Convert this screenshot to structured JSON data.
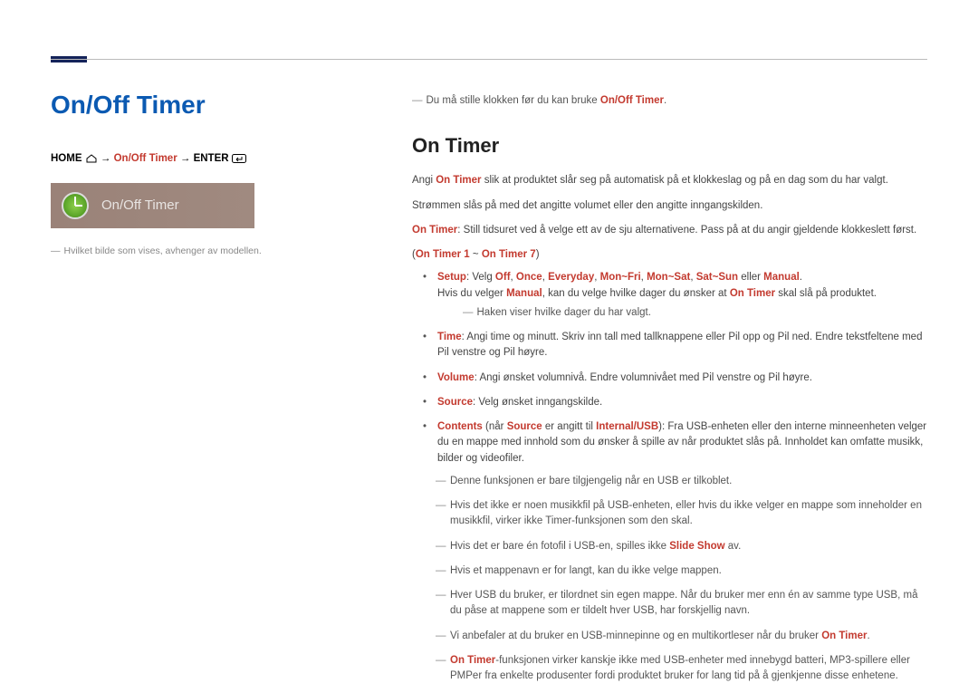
{
  "page": {
    "title": "On/Off Timer"
  },
  "breadcrumb": {
    "home": "HOME",
    "arrow": " → ",
    "mid": "On/Off Timer",
    "end": "ENTER"
  },
  "screenshot": {
    "label": "On/Off Timer"
  },
  "left_note": "Hvilket bilde som vises, avhenger av modellen.",
  "intro": {
    "text_before": "Du må stille klokken før du kan bruke ",
    "bold": "On/Off Timer",
    "text_after": "."
  },
  "section": {
    "title": "On Timer"
  },
  "p1": {
    "a": "Angi ",
    "b": "On Timer",
    "c": " slik at produktet slår seg på automatisk på et klokkeslag og på en dag som du har valgt."
  },
  "p2": "Strømmen slås på med det angitte volumet eller den angitte inngangskilden.",
  "p3": {
    "a": "On Timer",
    "b": ": Still tidsuret ved å velge ett av de sju alternativene. Pass på at du angir gjeldende klokkeslett først."
  },
  "range": {
    "lp": "(",
    "a": "On Timer 1",
    "mid": " ~ ",
    "b": "On Timer 7",
    "rp": ")"
  },
  "bullets": {
    "setup": {
      "label": "Setup",
      "a": ": Velg ",
      "off": "Off",
      "c1": ", ",
      "once": "Once",
      "c2": ", ",
      "everyday": "Everyday",
      "c3": ", ",
      "monfri": "Mon~Fri",
      "c4": ", ",
      "monsat": "Mon~Sat",
      "c5": ", ",
      "satsun": "Sat~Sun",
      "eller": " eller ",
      "manual": "Manual",
      "dot": ".",
      "line2a": "Hvis du velger ",
      "line2b": "Manual",
      "line2c": ", kan du velge hvilke dager du ønsker at ",
      "line2d": "On Timer",
      "line2e": " skal slå på produktet.",
      "sub": "Haken viser hvilke dager du har valgt."
    },
    "time": {
      "label": "Time",
      "text": ": Angi time og minutt. Skriv inn tall med tallknappene eller Pil opp og Pil ned. Endre tekstfeltene med Pil venstre og Pil høyre."
    },
    "volume": {
      "label": "Volume",
      "text": ": Angi ønsket volumnivå. Endre volumnivået med Pil venstre og Pil høyre."
    },
    "source": {
      "label": "Source",
      "text": ": Velg ønsket inngangskilde."
    },
    "contents": {
      "label": "Contents",
      "a": " (når ",
      "src": "Source",
      "b": " er angitt til ",
      "intusb": "Internal/USB",
      "c": "): Fra USB-enheten eller den interne minneenheten velger du en mappe med innhold som du ønsker å spille av når produktet slås på. Innholdet kan omfatte musikk, bilder og videofiler."
    }
  },
  "notes": {
    "n1": "Denne funksjonen er bare tilgjengelig når en USB er tilkoblet.",
    "n2": "Hvis det ikke er noen musikkfil på USB-enheten, eller hvis du ikke velger en mappe som inneholder en musikkfil, virker ikke Timer-funksjonen som den skal.",
    "n3a": "Hvis det er bare én fotofil i USB-en, spilles ikke ",
    "n3b": "Slide Show",
    "n3c": " av.",
    "n4": "Hvis et mappenavn er for langt, kan du ikke velge mappen.",
    "n5": "Hver USB du bruker, er tilordnet sin egen mappe. Når du bruker mer enn én av samme type USB, må du påse at mappene som er tildelt hver USB, har forskjellig navn.",
    "n6a": "Vi anbefaler at du bruker en USB-minnepinne og en multikortleser når du bruker ",
    "n6b": "On Timer",
    "n6c": ".",
    "n7a": "On Timer",
    "n7b": "-funksjonen virker kanskje ikke med USB-enheter med innebygd batteri, MP3-spillere eller PMPer fra enkelte produsenter fordi produktet bruker for lang tid på å gjenkjenne disse enhetene."
  }
}
